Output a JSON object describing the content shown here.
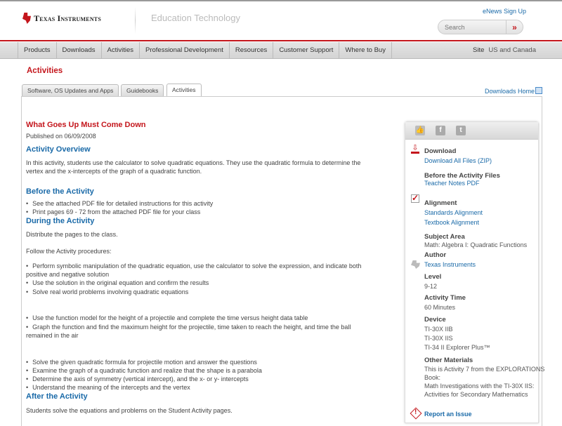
{
  "header": {
    "brand": "Texas Instruments",
    "section": "Education Technology",
    "enews": "eNews Sign Up",
    "search_placeholder": "Search",
    "search_go": "»"
  },
  "nav": {
    "items": [
      "Products",
      "Downloads",
      "Activities",
      "Professional Development",
      "Resources",
      "Customer Support",
      "Where to Buy"
    ],
    "site_label": "Site",
    "site_value": "US and Canada"
  },
  "page_title": "Activities",
  "tabs": [
    "Software, OS Updates and Apps",
    "Guidebooks",
    "Activities"
  ],
  "downloads_home": "Downloads Home",
  "main": {
    "title": "What Goes Up Must Come Down",
    "published": "Published on 06/09/2008",
    "overview_h": "Activity Overview",
    "overview_1": "In this activity, students use the calculator to solve quadratic equations. They use the quadratic formula to determine the",
    "overview_2": "vertex and the x-intercepts of the graph of a quadratic function.",
    "before_h": "Before the Activity",
    "before": [
      "See the attached PDF file for detailed instructions for this activity",
      "Print pages 69 - 72 from the attached PDF file for your class"
    ],
    "during_h": "During the Activity",
    "during_1": "Distribute the pages to the class.",
    "during_2": "Follow the Activity procedures:",
    "g1_1a": "Perform symbolic manipulation of the quadratic equation, use the calculator to solve the expression, and indicate both",
    "g1_1b": "positive and negative solution",
    "g1_2": "Use the solution in the original equation and confirm the results",
    "g1_3": "Solve real world problems involving quadratic equations",
    "g2_1": "Use the function model for the height of a projectile and complete the time versus height data table",
    "g2_2a": "Graph the function and find the maximum height for the projectile, time taken to reach the height, and time the ball",
    "g2_2b": "remained in the air",
    "g3": [
      "Solve the given quadratic formula for projectile motion and answer the questions",
      "Examine the graph of a quadratic function and realize that the shape is a parabola",
      "Determine the axis of symmetry (vertical intercept), and the x- or y- intercepts",
      "Understand the meaning of the intercepts and the vertex"
    ],
    "after_h": "After the Activity",
    "after": "Students solve the equations and problems on the Student Activity pages."
  },
  "sidebar": {
    "download_h": "Download",
    "download_all": "Download All Files (ZIP)",
    "before_h": "Before the Activity Files",
    "teacher_notes": "Teacher Notes PDF",
    "alignment_h": "Alignment",
    "standards": "Standards Alignment",
    "textbook": "Textbook Alignment",
    "subject_h": "Subject Area",
    "subject": "Math: Algebra I: Quadratic Functions",
    "author_h": "Author",
    "author": "Texas Instruments",
    "level_h": "Level",
    "level": "9-12",
    "time_h": "Activity Time",
    "time": "60 Minutes",
    "device_h": "Device",
    "devices": [
      "TI-30X IIB",
      "TI-30X IIS",
      "TI-34 II Explorer Plus™"
    ],
    "other_h": "Other Materials",
    "other": [
      "This is Activity 7 from the EXPLORATIONS",
      "Book:",
      "Math Investigations with the TI-30X IIS:",
      "Activities for Secondary Mathematics"
    ],
    "report": "Report an Issue"
  }
}
